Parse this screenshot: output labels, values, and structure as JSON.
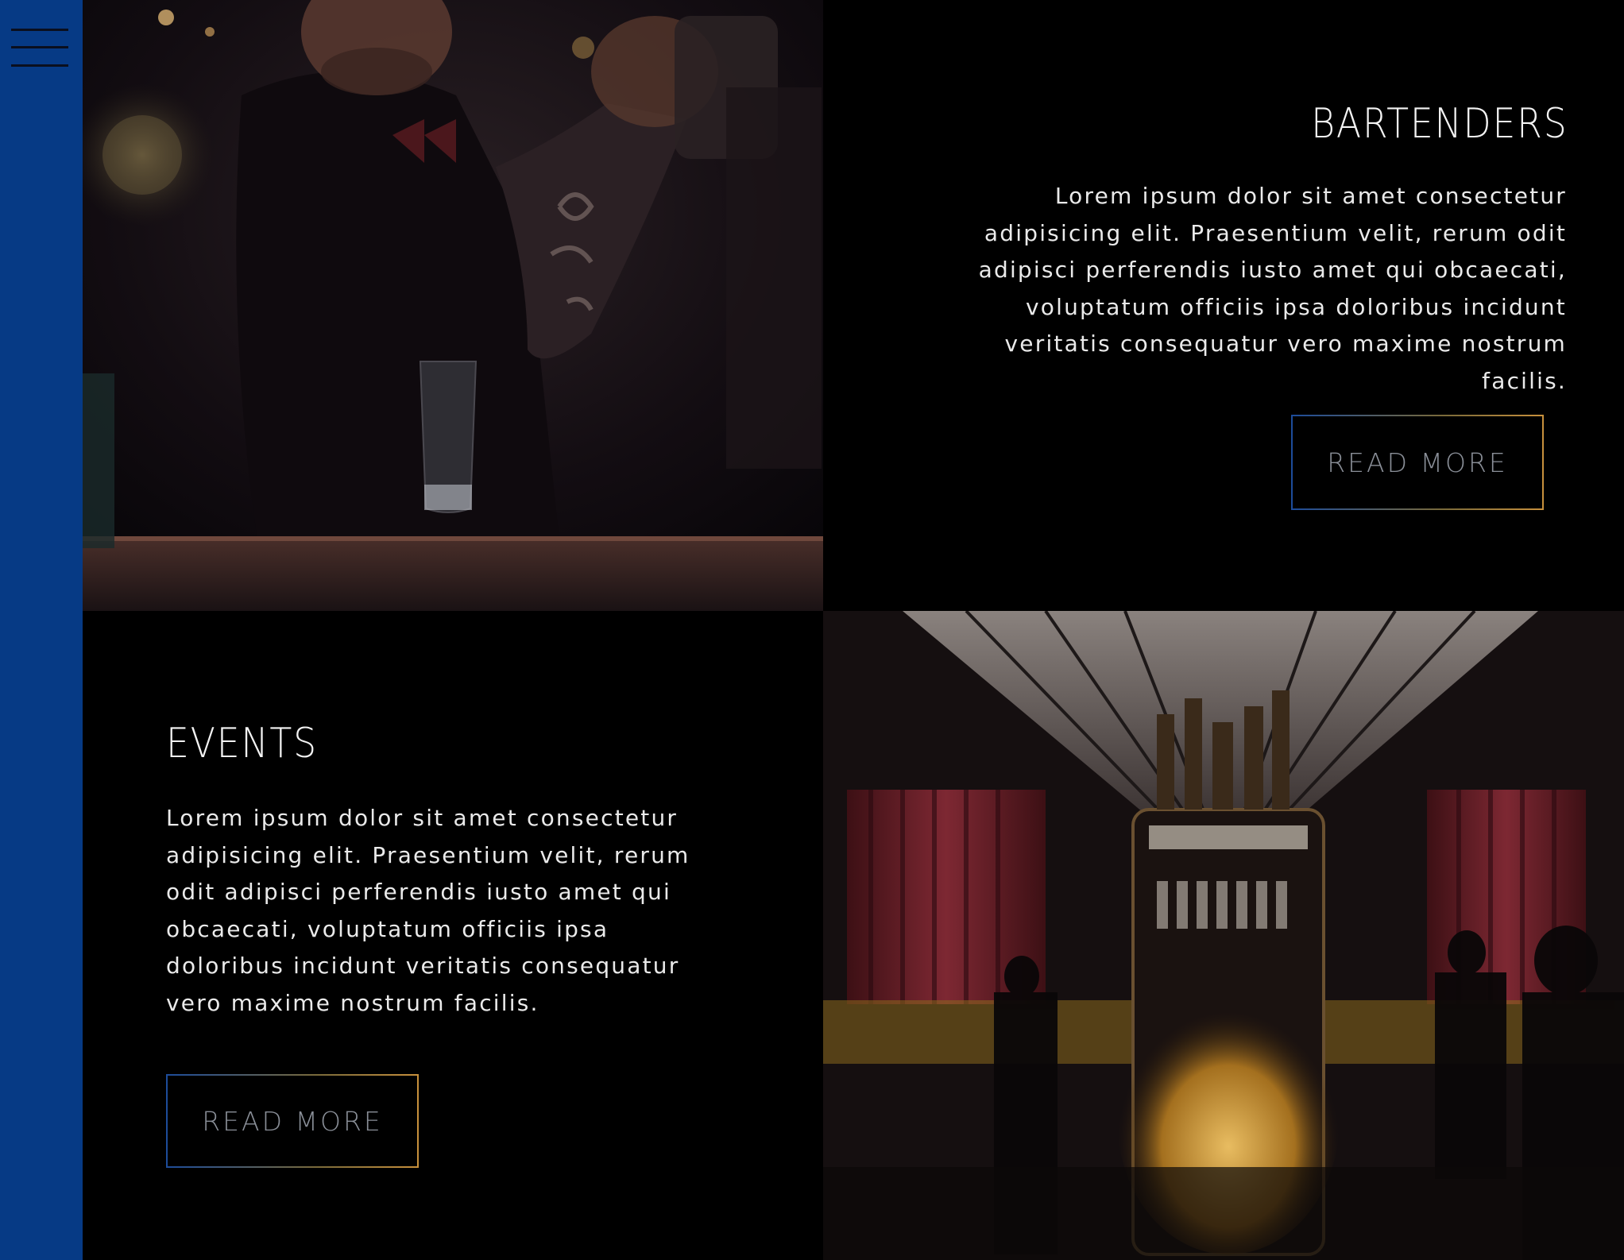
{
  "sidebar": {
    "menu_icon": "hamburger-menu-icon",
    "background_color": "#063a85"
  },
  "sections": {
    "bartenders": {
      "title": "BARTENDERS",
      "body": "Lorem ipsum dolor sit amet consectetur adipisicing elit. Praesentium velit, rerum odit adipisci perferendis iusto amet qui obcaecati, voluptatum officiis ipsa doloribus incidunt veritatis consequatur vero maxime nostrum facilis.",
      "button_label": "READ MORE",
      "image": "bartender-shaking-cocktail-photo"
    },
    "events": {
      "title": "EVENTS",
      "body": "Lorem ipsum dolor sit amet consectetur adipisicing elit. Praesentium velit, rerum odit adipisci perferendis iusto amet qui obcaecati, voluptatum officiis ipsa doloribus incidunt veritatis consequatur vero maxime nostrum facilis.",
      "button_label": "READ MORE",
      "image": "bar-interior-photo"
    }
  },
  "colors": {
    "background": "#000000",
    "accent_blue": "#1d4c9a",
    "accent_gold": "#c7903c"
  }
}
